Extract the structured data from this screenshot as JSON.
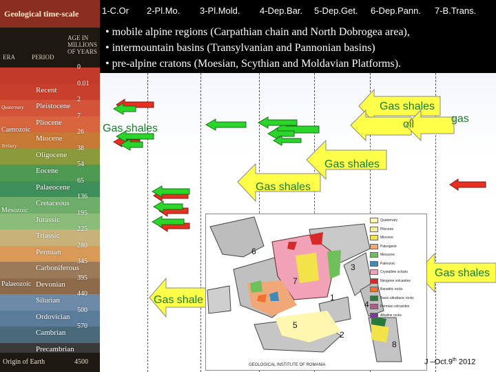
{
  "timescale": {
    "title": "Geological time-scale",
    "header_era": "ERA",
    "header_period": "PERIOD",
    "header_age": [
      "AGE IN",
      "MILLIONS",
      "OF YEARS"
    ],
    "eras": [
      {
        "label": "Quaternary",
        "small": true
      },
      {
        "label": "Caenozoic",
        "small": false
      },
      {
        "label": "Tertiary",
        "small": true
      },
      {
        "label": "Mesozoic",
        "small": false
      },
      {
        "label": "Palaeozoic",
        "small": false
      }
    ],
    "periods": [
      {
        "name": "",
        "age": "0",
        "color": "#c23a2a"
      },
      {
        "name": "Recent",
        "age": "0.01",
        "color": "#c8402c"
      },
      {
        "name": "Pleistocene",
        "age": "2",
        "color": "#d4543a"
      },
      {
        "name": "Pliocene",
        "age": "7",
        "color": "#d9653f"
      },
      {
        "name": "Miocene",
        "age": "26",
        "color": "#c77936"
      },
      {
        "name": "Oligocene",
        "age": "38",
        "color": "#8a9a3c"
      },
      {
        "name": "Eocene",
        "age": "54",
        "color": "#4f9a52"
      },
      {
        "name": "Palaeocene",
        "age": "65",
        "color": "#3f8f5a"
      },
      {
        "name": "Cretaceous",
        "age": "136",
        "color": "#6fae6a"
      },
      {
        "name": "Jurassic",
        "age": "195",
        "color": "#8cbc7a"
      },
      {
        "name": "Triassic",
        "age": "225",
        "color": "#c9b27a"
      },
      {
        "name": "Permian",
        "age": "280",
        "color": "#d99a57"
      },
      {
        "name": "Carboniferous",
        "age": "345",
        "color": "#9b7a5a"
      },
      {
        "name": "Devonian",
        "age": "395",
        "color": "#8c6a4a"
      },
      {
        "name": "Silurian",
        "age": "440",
        "color": "#6d8aa8"
      },
      {
        "name": "Ordovician",
        "age": "500",
        "color": "#5b7c9a"
      },
      {
        "name": "Cambrian",
        "age": "570",
        "color": "#4a6a7c"
      },
      {
        "name": "Precambrian",
        "age": "",
        "color": "#3a3a3a"
      }
    ],
    "origin_label": "Origin of Earth",
    "origin_age": "4500"
  },
  "topbar": {
    "tabs": [
      "1-C.Or",
      "2-Pl.Mo.",
      "3-Pl.Mold.",
      "4-Dep.Bar.",
      "5-Dep.Get.",
      "6-Dep.Pann.",
      "7-B.Trans."
    ]
  },
  "bullets": [
    "• mobile alpine regions (Carpathian chain and North Dobrogea area),",
    "• intermountain basins (Transylvanian and Pannonian basins)",
    "• pre-alpine cratons (Moesian,  Scythian and Moldavian Platforms)."
  ],
  "labels": {
    "gas_shales": "Gas shales",
    "gas_shales_cut": "Gas shale",
    "oil": "oil",
    "gas": "gas"
  },
  "map": {
    "legend": [
      {
        "label": "Quaternary",
        "color": "#fff6b0"
      },
      {
        "label": "Pliocene",
        "color": "#f6f0a0"
      },
      {
        "label": "Miocene",
        "color": "#f2e34a"
      },
      {
        "label": "Paleogene",
        "color": "#f0a878"
      },
      {
        "label": "Mesozoic",
        "color": "#6fbf5a"
      },
      {
        "label": "Paleozoic",
        "color": "#3e8ab8"
      },
      {
        "label": "Crystalline schists",
        "color": "#f2a2b6"
      },
      {
        "label": "Neogene volcanites",
        "color": "#d62a2a"
      },
      {
        "label": "Banatitic rocks",
        "color": "#f07030"
      },
      {
        "label": "Basic-ultrabasic rocks",
        "color": "#2a7a3a"
      },
      {
        "label": "Permian volcanites",
        "color": "#b05a8a"
      },
      {
        "label": "Alkaline rocks",
        "color": "#7a3a9a"
      }
    ],
    "zones": [
      "6",
      "3",
      "7",
      "1",
      "4",
      "5",
      "2",
      "8"
    ],
    "caption": "GEOLOGICAL INSTITUTE OF ROMANIA"
  },
  "footer": {
    "text": "J –Oct.9",
    "sup": "th",
    "year": " 2012"
  },
  "colors": {
    "red_arrow": "#e83020",
    "green_arrow": "#2bd62b",
    "yellow_arrow": "#ffff4a",
    "label_green": "#1a7a2a"
  }
}
